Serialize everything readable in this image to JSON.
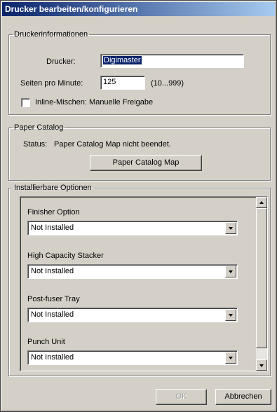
{
  "window": {
    "title": "Drucker bearbeiten/konfigurieren"
  },
  "printer_info": {
    "legend": "Druckerinformationen",
    "printer_label": "Drucker:",
    "printer_value": "Digimaster",
    "ppm_label": "Seiten pro Minute:",
    "ppm_value": "125",
    "ppm_range": "(10...999)",
    "inline_merge_label": "Inline-Mischen: Manuelle Freigabe",
    "inline_merge_checked": false
  },
  "paper_catalog": {
    "legend": "Paper Catalog",
    "status_label": "Status:",
    "status_text": "Paper Catalog Map nicht beendet.",
    "button_label": "Paper Catalog Map"
  },
  "installable_options": {
    "legend": "Installierbare Optionen",
    "options": [
      {
        "label": "Finisher Option",
        "value": "Not Installed"
      },
      {
        "label": "High Capacity Stacker",
        "value": "Not Installed"
      },
      {
        "label": "Post-fuser Tray",
        "value": "Not Installed"
      },
      {
        "label": "Punch Unit",
        "value": "Not Installed"
      }
    ]
  },
  "footer": {
    "ok_label": "OK",
    "cancel_label": "Abbrechen"
  },
  "colors": {
    "title_start": "#0a246a",
    "title_end": "#a6caf0",
    "face": "#d4d0c8",
    "selection": "#0a246a"
  }
}
